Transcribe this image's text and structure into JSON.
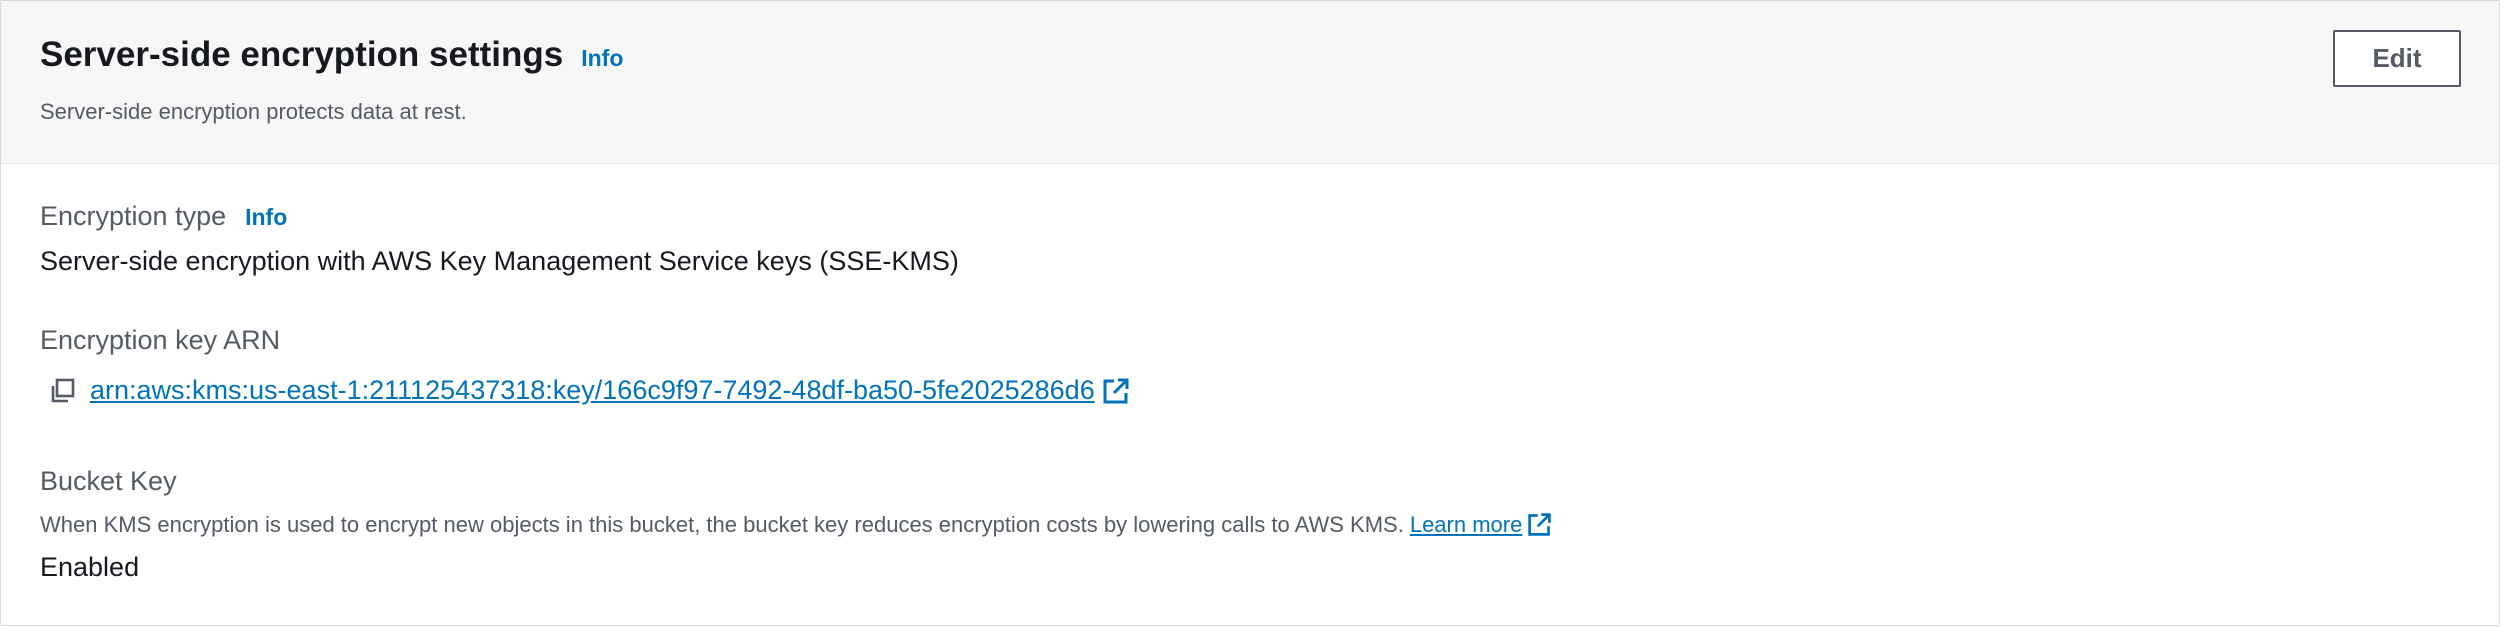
{
  "panel": {
    "title": "Server-side encryption settings",
    "title_info": "Info",
    "subtitle": "Server-side encryption protects data at rest.",
    "edit_label": "Edit"
  },
  "encryption_type": {
    "label": "Encryption type",
    "info": "Info",
    "value": "Server-side encryption with AWS Key Management Service keys (SSE-KMS)"
  },
  "encryption_key": {
    "label": "Encryption key ARN",
    "arn": "arn:aws:kms:us-east-1:211125437318:key/166c9f97-7492-48df-ba50-5fe2025286d6"
  },
  "bucket_key": {
    "label": "Bucket Key",
    "description": "When KMS encryption is used to encrypt new objects in this bucket, the bucket key reduces encryption costs by lowering calls to AWS KMS.",
    "learn_more": "Learn more",
    "value": "Enabled"
  },
  "icons": {
    "copy": "copy-icon",
    "external": "external-link-icon"
  },
  "colors": {
    "link": "#0073bb",
    "text": "#16191f",
    "muted": "#545b64",
    "header_bg": "#f7f7f7"
  }
}
